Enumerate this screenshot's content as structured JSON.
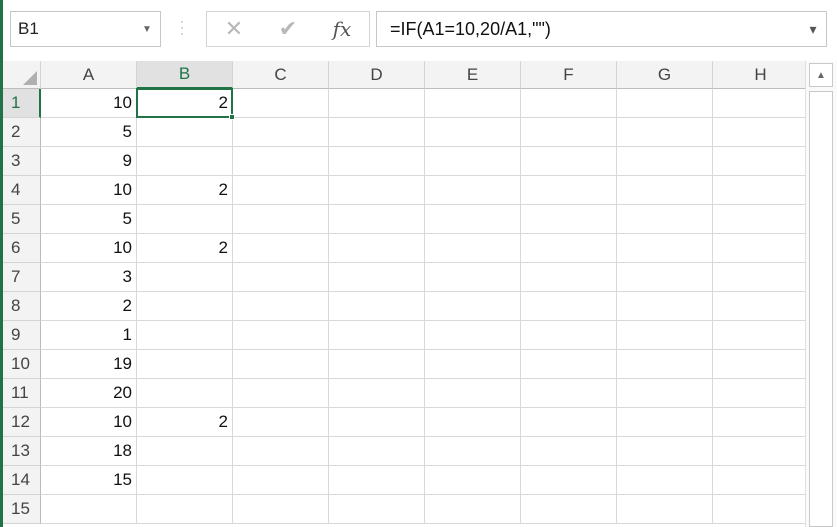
{
  "name_box": {
    "value": "B1"
  },
  "formula_bar": {
    "cancel_glyph": "✕",
    "enter_glyph": "✔",
    "fx_label": "fx",
    "formula": "=IF(A1=10,20/A1,\"\")"
  },
  "columns": [
    "A",
    "B",
    "C",
    "D",
    "E",
    "F",
    "G",
    "H"
  ],
  "rows": [
    "1",
    "2",
    "3",
    "4",
    "5",
    "6",
    "7",
    "8",
    "9",
    "10",
    "11",
    "12",
    "13",
    "14",
    "15"
  ],
  "cells": {
    "A": [
      "10",
      "5",
      "9",
      "10",
      "5",
      "10",
      "3",
      "2",
      "1",
      "19",
      "20",
      "10",
      "18",
      "15",
      ""
    ],
    "B": [
      "2",
      "",
      "",
      "2",
      "",
      "2",
      "",
      "",
      "",
      "",
      "",
      "2",
      "",
      "",
      ""
    ]
  },
  "selection": {
    "column": "B",
    "row": "1"
  },
  "colors": {
    "accent": "#217346"
  }
}
